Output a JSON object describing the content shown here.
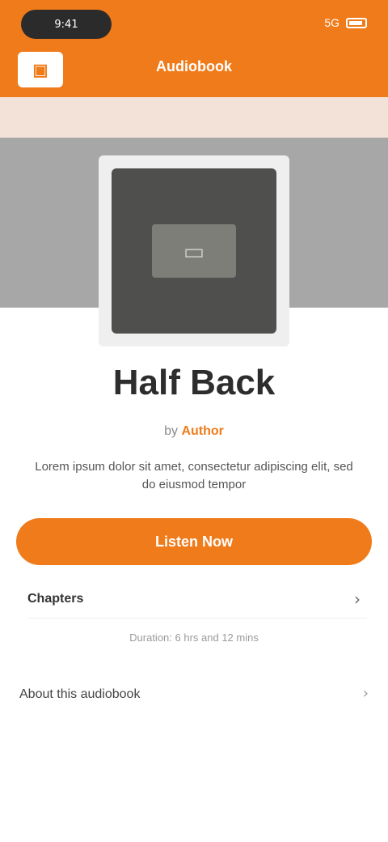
{
  "status_bar": {
    "time": "9:41",
    "signal": "5G"
  },
  "nav": {
    "logo_text": "▣",
    "title": "Audiobook"
  },
  "subband": {
    "label": ""
  },
  "book": {
    "art_icon": "▭",
    "title": "Half Back",
    "by_prefix": "by",
    "author": "Author",
    "description": "Lorem ipsum dolor sit amet, consectetur adipiscing elit, sed do eiusmod tempor"
  },
  "cta": {
    "label": "Listen Now"
  },
  "row": {
    "label": "Chapters"
  },
  "note": {
    "text": "Duration: 6 hrs and 12 mins"
  },
  "section": {
    "label": "About this audiobook"
  },
  "colors": {
    "accent": "#f07b1a",
    "hero_bg": "#a7a7a7",
    "art_bg": "#4f4f4d"
  },
  "icons": {
    "logo": "app-logo-icon",
    "chevron": "chevron-right-icon",
    "battery": "battery-icon"
  }
}
